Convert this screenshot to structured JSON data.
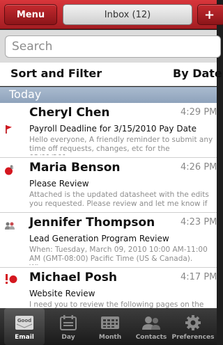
{
  "header": {
    "menu_label": "Menu",
    "inbox_label": "Inbox (12)",
    "add_label": "+"
  },
  "search": {
    "placeholder": "Search"
  },
  "sort": {
    "title": "Sort and Filter",
    "value": "By Date"
  },
  "section": {
    "label": "Today"
  },
  "messages": [
    {
      "sender": "Cheryl Chen",
      "time": "4:29 PM",
      "subject": "Payroll Deadline for 3/15/2010 Pay Date",
      "preview": "Hello everyone, A friendly reminder to submit any time off requests, changes, etc for the 03/01/201...",
      "icon": "red-flag-icon"
    },
    {
      "sender": "Maria Benson",
      "time": "4:26 PM",
      "subject": "Please Review",
      "preview": "Attached is the updated datasheet with the edits you requested. Please review and let me know if ...",
      "icon": "unread-attachment-icon"
    },
    {
      "sender": "Jennifer Thompson",
      "time": "4:23 PM",
      "subject": "Lead Generation Program Review",
      "preview": "When: Tuesday, March 09, 2010 10:00 AM-11:00 AM (GMT-08:00) Pacific Time (US & Canada). Whe...",
      "icon": "meeting-people-icon"
    },
    {
      "sender": "Michael Posh",
      "time": "4:17 PM",
      "subject": "Website Review",
      "preview": "I need you to review the following pages on the",
      "icon": "high-priority-unread-icon"
    }
  ],
  "tabs": [
    {
      "label": "Email",
      "icon": "good-email-icon",
      "active": true
    },
    {
      "label": "Day",
      "icon": "day-calendar-icon",
      "active": false
    },
    {
      "label": "Month",
      "icon": "month-calendar-icon",
      "active": false
    },
    {
      "label": "Contacts",
      "icon": "contacts-icon",
      "active": false
    },
    {
      "label": "Preferences",
      "icon": "gear-icon",
      "active": false
    }
  ],
  "colors": {
    "accent_red": "#c42a2f",
    "section_blue": "#9aaec6",
    "tabbar_dark": "#1e1e1e"
  }
}
